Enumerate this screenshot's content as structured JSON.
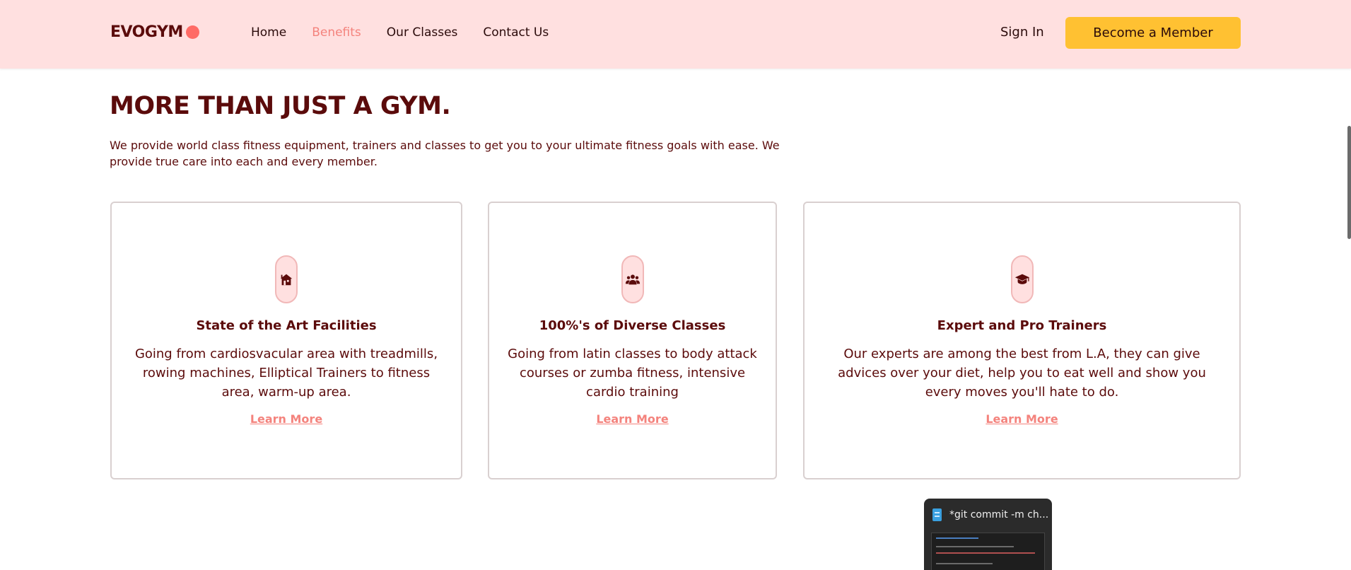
{
  "nav": {
    "logo": "EVOGYM",
    "links": [
      {
        "label": "Home",
        "active": false
      },
      {
        "label": "Benefits",
        "active": true
      },
      {
        "label": "Our Classes",
        "active": false
      },
      {
        "label": "Contact Us",
        "active": false
      }
    ],
    "sign_in": "Sign In",
    "cta": "Become a Member"
  },
  "section": {
    "title": "MORE THAN JUST A GYM.",
    "intro": "We provide world class fitness equipment, trainers and classes to get you to your ultimate fitness goals with ease. We provide true care into each and every member."
  },
  "cards": [
    {
      "icon": "home-building-icon",
      "title": "State of the Art Facilities",
      "text": "Going from cardiosvacular area with treadmills, rowing machines, Elliptical Trainers to fitness area, warm-up area.",
      "link": "Learn More"
    },
    {
      "icon": "user-group-icon",
      "title": "100%'s of Diverse Classes",
      "text": "Going from latin classes to body attack courses or zumba fitness, intensive cardio training",
      "link": "Learn More"
    },
    {
      "icon": "graduation-cap-icon",
      "title": "Expert and Pro Trainers",
      "text": "Our experts are among the best from L.A, they can give advices over your diet, help you to eat well and show you every moves you'll hate to do.",
      "link": "Learn More"
    }
  ],
  "taskbar_preview": {
    "title": "*git commit -m ch..."
  },
  "colors": {
    "nav_bg": "#ffe0e0",
    "primary_text": "#5b0b0b",
    "accent": "#f4837d",
    "cta_bg": "#ffc132",
    "logo_dot": "#ff6b66"
  }
}
